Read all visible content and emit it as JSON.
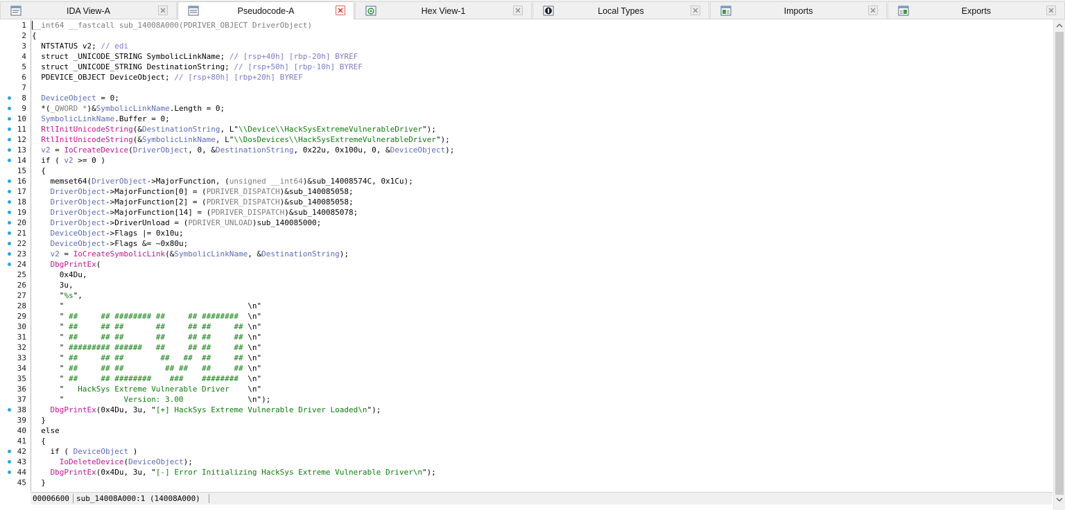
{
  "tabs": [
    {
      "label": "IDA View-A",
      "icon": "ida-view-icon",
      "active": false
    },
    {
      "label": "Pseudocode-A",
      "icon": "pseudocode-icon",
      "active": true
    },
    {
      "label": "Hex View-1",
      "icon": "hex-view-icon",
      "active": false
    },
    {
      "label": "Local Types",
      "icon": "local-types-icon",
      "active": false
    },
    {
      "label": "Imports",
      "icon": "imports-icon",
      "active": false
    },
    {
      "label": "Exports",
      "icon": "exports-icon",
      "active": false
    }
  ],
  "colors": {
    "keyword": "#000000",
    "variable": "#5b6bb5",
    "comment": "#7b7bc9",
    "function": "#c0148e",
    "string": "#0d7b0d",
    "type_cast": "#7d7d7d",
    "breakpoint_dot": "#2fa3d9"
  },
  "code": {
    "bullet_lines": [
      8,
      9,
      10,
      11,
      12,
      13,
      14,
      16,
      17,
      18,
      19,
      20,
      21,
      22,
      23,
      24,
      38,
      42,
      43,
      44
    ],
    "lines": [
      [
        [
          "__int64 __fastcall sub_14008A000(PDRIVER_OBJECT DriverObject)",
          "t"
        ]
      ],
      [
        [
          "{",
          "k"
        ]
      ],
      [
        [
          "  NTSTATUS v2; ",
          "k"
        ],
        [
          "// edi",
          "c"
        ]
      ],
      [
        [
          "  struct _UNICODE_STRING SymbolicLinkName; ",
          "k"
        ],
        [
          "// [rsp+40h] [rbp-20h] BYREF",
          "c"
        ]
      ],
      [
        [
          "  struct _UNICODE_STRING DestinationString; ",
          "k"
        ],
        [
          "// [rsp+50h] [rbp-10h] BYREF",
          "c"
        ]
      ],
      [
        [
          "  PDEVICE_OBJECT DeviceObject; ",
          "k"
        ],
        [
          "// [rsp+80h] [rbp+20h] BYREF",
          "c"
        ]
      ],
      [
        [
          "",
          "k"
        ]
      ],
      [
        [
          "  ",
          "k"
        ],
        [
          "DeviceObject",
          "v"
        ],
        [
          " = 0;",
          "k"
        ]
      ],
      [
        [
          "  *(",
          "k"
        ],
        [
          "_QWORD *",
          "t"
        ],
        [
          ")&",
          "k"
        ],
        [
          "SymbolicLinkName",
          "v"
        ],
        [
          ".Length = 0;",
          "k"
        ]
      ],
      [
        [
          "  ",
          "k"
        ],
        [
          "SymbolicLinkName",
          "v"
        ],
        [
          ".Buffer = 0;",
          "k"
        ]
      ],
      [
        [
          "  ",
          "k"
        ],
        [
          "RtlInitUnicodeString",
          "f"
        ],
        [
          "(&",
          "k"
        ],
        [
          "DestinationString",
          "v"
        ],
        [
          ", L\"",
          "k"
        ],
        [
          "\\\\Device\\\\HackSysExtremeVulnerableDriver",
          "s"
        ],
        [
          "\");",
          "k"
        ]
      ],
      [
        [
          "  ",
          "k"
        ],
        [
          "RtlInitUnicodeString",
          "f"
        ],
        [
          "(&",
          "k"
        ],
        [
          "SymbolicLinkName",
          "v"
        ],
        [
          ", L\"",
          "k"
        ],
        [
          "\\\\DosDevices\\\\HackSysExtremeVulnerableDriver",
          "s"
        ],
        [
          "\");",
          "k"
        ]
      ],
      [
        [
          "  ",
          "k"
        ],
        [
          "v2",
          "v"
        ],
        [
          " = ",
          "k"
        ],
        [
          "IoCreateDevice",
          "f"
        ],
        [
          "(",
          "k"
        ],
        [
          "DriverObject",
          "v"
        ],
        [
          ", 0, &",
          "k"
        ],
        [
          "DestinationString",
          "v"
        ],
        [
          ", 0x22u, 0x100u, 0, &",
          "k"
        ],
        [
          "DeviceObject",
          "v"
        ],
        [
          ");",
          "k"
        ]
      ],
      [
        [
          "  if ( ",
          "k"
        ],
        [
          "v2",
          "v"
        ],
        [
          " >= 0 )",
          "k"
        ]
      ],
      [
        [
          "  {",
          "k"
        ]
      ],
      [
        [
          "    memset64(",
          "k"
        ],
        [
          "DriverObject",
          "v"
        ],
        [
          "->MajorFunction, (",
          "k"
        ],
        [
          "unsigned __int64",
          "t"
        ],
        [
          ")&sub_14008574C, 0x1Cu);",
          "k"
        ]
      ],
      [
        [
          "    ",
          "k"
        ],
        [
          "DriverObject",
          "v"
        ],
        [
          "->MajorFunction[0] = (",
          "k"
        ],
        [
          "PDRIVER_DISPATCH",
          "t"
        ],
        [
          ")&sub_140085058;",
          "k"
        ]
      ],
      [
        [
          "    ",
          "k"
        ],
        [
          "DriverObject",
          "v"
        ],
        [
          "->MajorFunction[2] = (",
          "k"
        ],
        [
          "PDRIVER_DISPATCH",
          "t"
        ],
        [
          ")&sub_140085058;",
          "k"
        ]
      ],
      [
        [
          "    ",
          "k"
        ],
        [
          "DriverObject",
          "v"
        ],
        [
          "->MajorFunction[14] = (",
          "k"
        ],
        [
          "PDRIVER_DISPATCH",
          "t"
        ],
        [
          ")&sub_140085078;",
          "k"
        ]
      ],
      [
        [
          "    ",
          "k"
        ],
        [
          "DriverObject",
          "v"
        ],
        [
          "->DriverUnload = (",
          "k"
        ],
        [
          "PDRIVER_UNLOAD",
          "t"
        ],
        [
          ")sub_140085000;",
          "k"
        ]
      ],
      [
        [
          "    ",
          "k"
        ],
        [
          "DeviceObject",
          "v"
        ],
        [
          "->Flags |= 0x10u;",
          "k"
        ]
      ],
      [
        [
          "    ",
          "k"
        ],
        [
          "DeviceObject",
          "v"
        ],
        [
          "->Flags &= ~0x80u;",
          "k"
        ]
      ],
      [
        [
          "    ",
          "k"
        ],
        [
          "v2",
          "v"
        ],
        [
          " = ",
          "k"
        ],
        [
          "IoCreateSymbolicLink",
          "f"
        ],
        [
          "(&",
          "k"
        ],
        [
          "SymbolicLinkName",
          "v"
        ],
        [
          ", &",
          "k"
        ],
        [
          "DestinationString",
          "v"
        ],
        [
          ");",
          "k"
        ]
      ],
      [
        [
          "    ",
          "k"
        ],
        [
          "DbgPrintEx",
          "f"
        ],
        [
          "(",
          "k"
        ]
      ],
      [
        [
          "      0x4Du,",
          "k"
        ]
      ],
      [
        [
          "      3u,",
          "k"
        ]
      ],
      [
        [
          "      \"",
          "k"
        ],
        [
          "%s",
          "s"
        ],
        [
          "\",",
          "k"
        ]
      ],
      [
        [
          "      \"",
          "k"
        ],
        [
          "                                        ",
          "s"
        ],
        [
          "\\n\"",
          "k"
        ]
      ],
      [
        [
          "      \"",
          "k"
        ],
        [
          " ##     ## ######## ##     ## ######## ",
          "s"
        ],
        [
          " \\n\"",
          "k"
        ]
      ],
      [
        [
          "      \"",
          "k"
        ],
        [
          " ##     ## ##       ##     ## ##     ##",
          "s"
        ],
        [
          " \\n\"",
          "k"
        ]
      ],
      [
        [
          "      \"",
          "k"
        ],
        [
          " ##     ## ##       ##     ## ##     ##",
          "s"
        ],
        [
          " \\n\"",
          "k"
        ]
      ],
      [
        [
          "      \"",
          "k"
        ],
        [
          " ######### ######   ##     ## ##     ##",
          "s"
        ],
        [
          " \\n\"",
          "k"
        ]
      ],
      [
        [
          "      \"",
          "k"
        ],
        [
          " ##     ## ##        ##   ##  ##     ##",
          "s"
        ],
        [
          " \\n\"",
          "k"
        ]
      ],
      [
        [
          "      \"",
          "k"
        ],
        [
          " ##     ## ##         ## ##   ##     ##",
          "s"
        ],
        [
          " \\n\"",
          "k"
        ]
      ],
      [
        [
          "      \"",
          "k"
        ],
        [
          " ##     ## ########    ###    ######## ",
          "s"
        ],
        [
          " \\n\"",
          "k"
        ]
      ],
      [
        [
          "      \"",
          "k"
        ],
        [
          "   HackSys Extreme Vulnerable Driver    ",
          "s"
        ],
        [
          "\\n\"",
          "k"
        ]
      ],
      [
        [
          "      \"",
          "k"
        ],
        [
          "             Version: 3.00              ",
          "s"
        ],
        [
          "\\n\");",
          "k"
        ]
      ],
      [
        [
          "    ",
          "k"
        ],
        [
          "DbgPrintEx",
          "f"
        ],
        [
          "(0x4Du, 3u, \"",
          "k"
        ],
        [
          "[+] HackSys Extreme Vulnerable Driver Loaded\\n",
          "s"
        ],
        [
          "\");",
          "k"
        ]
      ],
      [
        [
          "  }",
          "k"
        ]
      ],
      [
        [
          "  else",
          "k"
        ]
      ],
      [
        [
          "  {",
          "k"
        ]
      ],
      [
        [
          "    if ( ",
          "k"
        ],
        [
          "DeviceObject",
          "v"
        ],
        [
          " )",
          "k"
        ]
      ],
      [
        [
          "      ",
          "k"
        ],
        [
          "IoDeleteDevice",
          "f"
        ],
        [
          "(",
          "k"
        ],
        [
          "DeviceObject",
          "v"
        ],
        [
          ");",
          "k"
        ]
      ],
      [
        [
          "    ",
          "k"
        ],
        [
          "DbgPrintEx",
          "f"
        ],
        [
          "(0x4Du, 3u, \"",
          "k"
        ],
        [
          "[-] Error Initializing HackSys Extreme Vulnerable Driver\\n",
          "s"
        ],
        [
          "\");",
          "k"
        ]
      ],
      [
        [
          "  }",
          "k"
        ]
      ]
    ]
  },
  "status": {
    "offset": "00006600",
    "location": "sub_14008A000:1 (14008A000)"
  }
}
